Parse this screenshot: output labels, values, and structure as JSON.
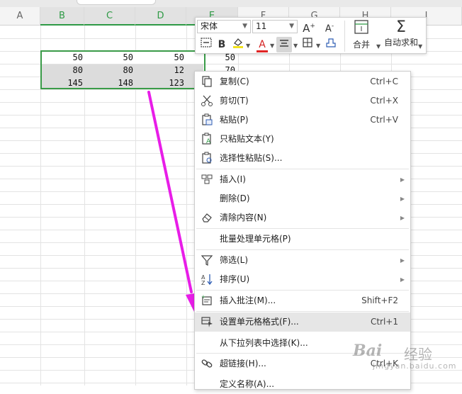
{
  "columns": [
    "A",
    "B",
    "C",
    "D",
    "E",
    "F",
    "G",
    "H",
    "I"
  ],
  "cells": {
    "rows": [
      [
        "50",
        "50",
        "50",
        "50"
      ],
      [
        "80",
        "80",
        "12",
        "70"
      ],
      [
        "145",
        "148",
        "123",
        ""
      ]
    ]
  },
  "toolbar": {
    "font_name": "宋体",
    "font_size": "11",
    "bold": "B",
    "font_color": "A",
    "merge_label": "合并",
    "autosum_label": "自动求和"
  },
  "menu": {
    "items": [
      {
        "label": "复制(C)",
        "shortcut": "Ctrl+C",
        "icon": "copy-icon"
      },
      {
        "label": "剪切(T)",
        "shortcut": "Ctrl+X",
        "icon": "cut-icon"
      },
      {
        "label": "粘贴(P)",
        "shortcut": "Ctrl+V",
        "icon": "paste-icon"
      },
      {
        "label": "只粘贴文本(Y)",
        "shortcut": "",
        "icon": "paste-text-icon"
      },
      {
        "label": "选择性粘贴(S)...",
        "shortcut": "",
        "icon": "paste-special-icon"
      },
      {
        "label": "插入(I)",
        "shortcut": "",
        "icon": "insert-icon",
        "submenu": true
      },
      {
        "label": "删除(D)",
        "shortcut": "",
        "icon": "",
        "submenu": true
      },
      {
        "label": "清除内容(N)",
        "shortcut": "",
        "icon": "eraser-icon",
        "submenu": true
      },
      {
        "label": "批量处理单元格(P)",
        "shortcut": "",
        "icon": ""
      },
      {
        "label": "筛选(L)",
        "shortcut": "",
        "icon": "filter-icon",
        "submenu": true
      },
      {
        "label": "排序(U)",
        "shortcut": "",
        "icon": "sort-icon",
        "submenu": true
      },
      {
        "label": "插入批注(M)...",
        "shortcut": "Shift+F2",
        "icon": "comment-icon"
      },
      {
        "label": "设置单元格格式(F)...",
        "shortcut": "Ctrl+1",
        "icon": "format-cells-icon",
        "highlighted": true
      },
      {
        "label": "从下拉列表中选择(K)...",
        "shortcut": "",
        "icon": ""
      },
      {
        "label": "超链接(H)...",
        "shortcut": "Ctrl+K",
        "icon": "link-icon"
      },
      {
        "label": "定义名称(A)...",
        "shortcut": "",
        "icon": ""
      }
    ]
  },
  "watermark": {
    "brand": "Bai",
    "brand_cn": "经验",
    "url": "jingyan.baidu.com"
  },
  "colors": {
    "selection_border": "#3a9b48",
    "selected_header_text": "#2e9a45",
    "arrow": "#e81de8",
    "menu_highlight": "#e6e6e6"
  }
}
